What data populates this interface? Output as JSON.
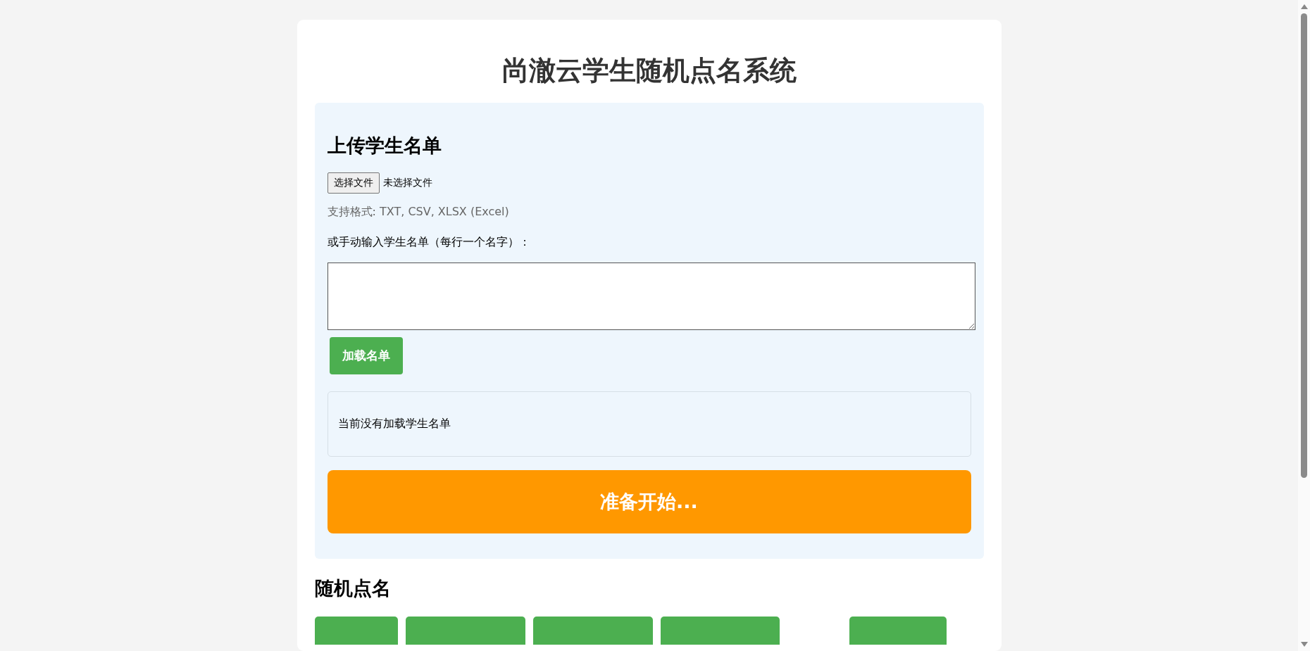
{
  "title": "尚澈云学生随机点名系统",
  "upload": {
    "heading": "上传学生名单",
    "file_button": "选择文件",
    "file_status": "未选择文件",
    "formats": "支持格式: TXT, CSV, XLSX (Excel)",
    "manual_label": "或手动输入学生名单（每行一个名字）：",
    "load_button": "加载名单",
    "list_status": "当前没有加载学生名单",
    "start_button": "准备开始..."
  },
  "roll_call": {
    "heading": "随机点名",
    "actions": [
      {
        "kind": "filled"
      },
      {
        "kind": "filled"
      },
      {
        "kind": "filled"
      },
      {
        "kind": "filled"
      },
      {
        "kind": "blank"
      },
      {
        "kind": "filled"
      }
    ]
  }
}
